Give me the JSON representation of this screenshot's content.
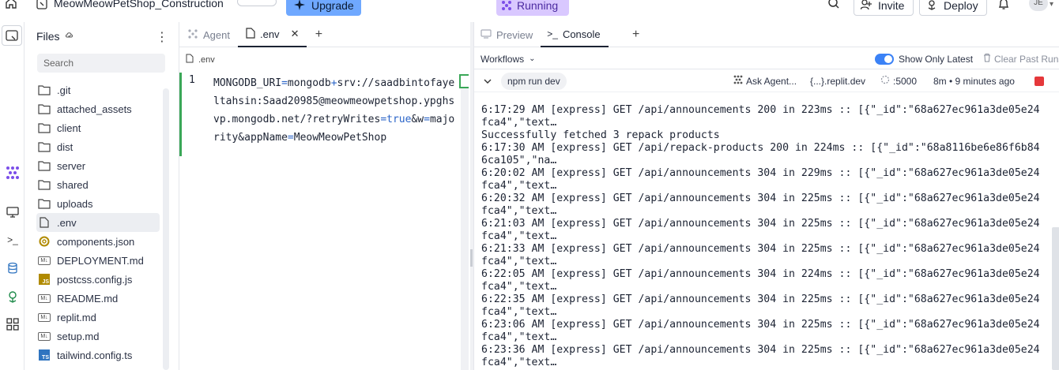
{
  "topbar": {
    "project_name": "MeowMeowPetShop_Construction",
    "upgrade_label": "Upgrade",
    "running_label": "Running",
    "invite_label": "Invite",
    "deploy_label": "Deploy",
    "avatar_initials": "JE",
    "icons": [
      "home-icon",
      "project-icon",
      "sparkle-icon",
      "agent-icon",
      "search-icon",
      "user-plus-icon",
      "deploy-icon",
      "bell-icon",
      "chevron-down-icon"
    ],
    "colors": {
      "upgrade_bg": "#6fa8ff",
      "running_bg": "#d9c8ff"
    }
  },
  "files": {
    "title": "Files",
    "search_placeholder": "Search",
    "items": [
      {
        "name": ".git",
        "icon": "folder-icon"
      },
      {
        "name": "attached_assets",
        "icon": "folder-icon"
      },
      {
        "name": "client",
        "icon": "folder-icon"
      },
      {
        "name": "dist",
        "icon": "folder-icon"
      },
      {
        "name": "server",
        "icon": "folder-icon"
      },
      {
        "name": "shared",
        "icon": "folder-icon"
      },
      {
        "name": "uploads",
        "icon": "folder-icon"
      },
      {
        "name": ".env",
        "icon": "file-icon",
        "selected": true
      },
      {
        "name": "components.json",
        "icon": "json-icon"
      },
      {
        "name": "DEPLOYMENT.md",
        "icon": "markdown-icon"
      },
      {
        "name": "postcss.config.js",
        "icon": "js-icon"
      },
      {
        "name": "README.md",
        "icon": "markdown-icon"
      },
      {
        "name": "replit.md",
        "icon": "markdown-icon"
      },
      {
        "name": "setup.md",
        "icon": "markdown-icon"
      },
      {
        "name": "tailwind.config.ts",
        "icon": "ts-icon"
      }
    ]
  },
  "editor": {
    "tabs": [
      {
        "label": "Agent",
        "active": false
      },
      {
        "label": ".env",
        "active": true
      }
    ],
    "breadcrumb": ".env",
    "line_number": "1",
    "code_parts": [
      {
        "t": "MONGODB_URI",
        "c": ""
      },
      {
        "t": "=",
        "c": "op"
      },
      {
        "t": "mongodb",
        "c": ""
      },
      {
        "t": "+",
        "c": "op"
      },
      {
        "t": "srv://saadbintofayeltahsin:Saad20985@meowmeowpetshop.ypghsvp.mongodb.net/?retryWrites",
        "c": ""
      },
      {
        "t": "=",
        "c": "op"
      },
      {
        "t": "true",
        "c": "kw"
      },
      {
        "t": "&w",
        "c": ""
      },
      {
        "t": "=",
        "c": "op"
      },
      {
        "t": "majority&appName",
        "c": ""
      },
      {
        "t": "=",
        "c": "op"
      },
      {
        "t": "MeowMeowPetShop",
        "c": ""
      }
    ]
  },
  "console": {
    "tabs": [
      {
        "label": "Preview",
        "active": false
      },
      {
        "label": "Console",
        "active": true
      }
    ],
    "workflows_label": "Workflows",
    "show_only_latest_label": "Show Only Latest",
    "show_only_latest_on": true,
    "clear_label": "Clear Past Runs",
    "run": {
      "command": "npm run dev",
      "ask_agent": "Ask Agent...",
      "domain": "{...}.replit.dev",
      "port": ":5000",
      "age": "8m • 9 minutes ago"
    },
    "log_lines": [
      "6:17:29 AM [express] GET /api/announcements 200 in 223ms :: [{\"_id\":\"68a627ec961a3de05e24fca4\",\"text…",
      "Successfully fetched 3 repack products",
      "6:17:30 AM [express] GET /api/repack-products 200 in 224ms :: [{\"_id\":\"68a8116be6e86f6b846ca105\",\"na…",
      "6:20:02 AM [express] GET /api/announcements 304 in 229ms :: [{\"_id\":\"68a627ec961a3de05e24fca4\",\"text…",
      "6:20:32 AM [express] GET /api/announcements 304 in 225ms :: [{\"_id\":\"68a627ec961a3de05e24fca4\",\"text…",
      "6:21:03 AM [express] GET /api/announcements 304 in 225ms :: [{\"_id\":\"68a627ec961a3de05e24fca4\",\"text…",
      "6:21:33 AM [express] GET /api/announcements 304 in 225ms :: [{\"_id\":\"68a627ec961a3de05e24fca4\",\"text…",
      "6:22:05 AM [express] GET /api/announcements 304 in 224ms :: [{\"_id\":\"68a627ec961a3de05e24fca4\",\"text…",
      "6:22:35 AM [express] GET /api/announcements 304 in 225ms :: [{\"_id\":\"68a627ec961a3de05e24fca4\",\"text…",
      "6:23:06 AM [express] GET /api/announcements 304 in 225ms :: [{\"_id\":\"68a627ec961a3de05e24fca4\",\"text…",
      "6:23:36 AM [express] GET /api/announcements 304 in 225ms :: [{\"_id\":\"68a627ec961a3de05e24fca4\",\"text…"
    ]
  }
}
